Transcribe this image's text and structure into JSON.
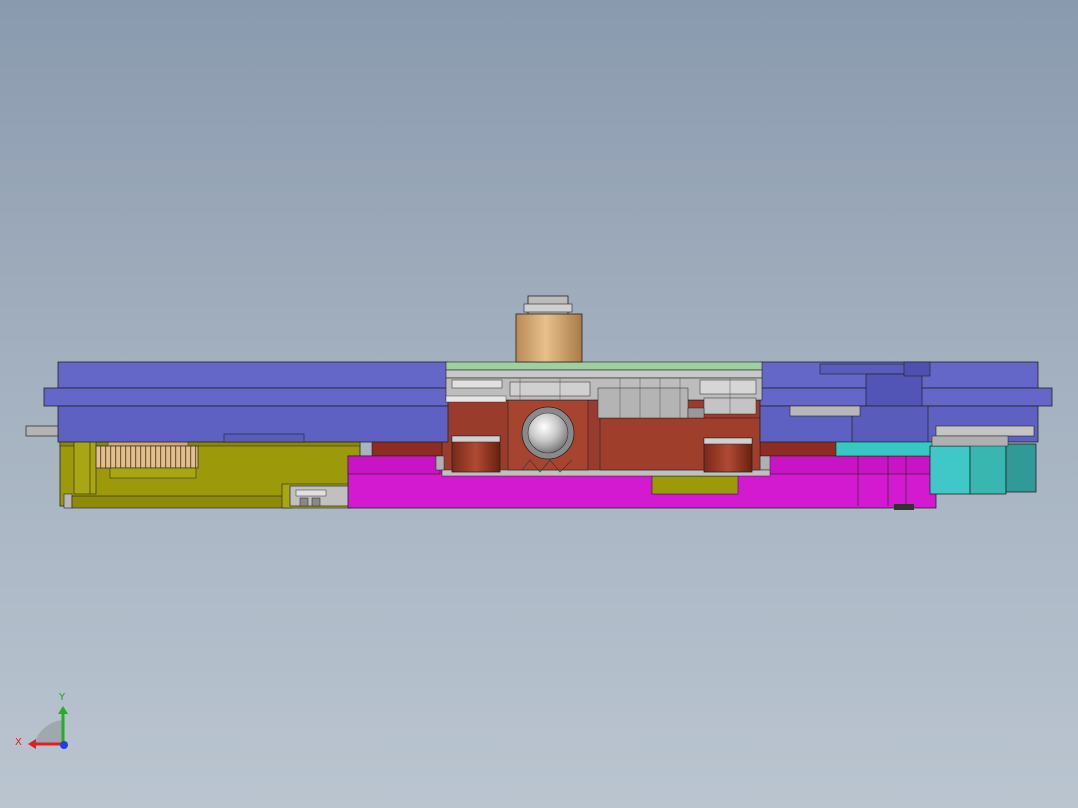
{
  "viewport": {
    "background_top": "#8a9aae",
    "background_bottom": "#bac5d0"
  },
  "model": {
    "colors": {
      "blue_plate": "#6466c8",
      "blue_plate_dark": "#4a4ca8",
      "olive_base": "#9c9a0a",
      "magenta_base": "#d41ad0",
      "brown_block": "#9a3c2c",
      "tan_cylinder": "#d8ae78",
      "cyan_block": "#40c8c8",
      "gray_steel": "#b8b8b8"
    }
  },
  "triad": {
    "x_label": "X",
    "y_label": "Y",
    "x_color": "#e02020",
    "y_color": "#20b020",
    "z_color": "#2040e0"
  }
}
